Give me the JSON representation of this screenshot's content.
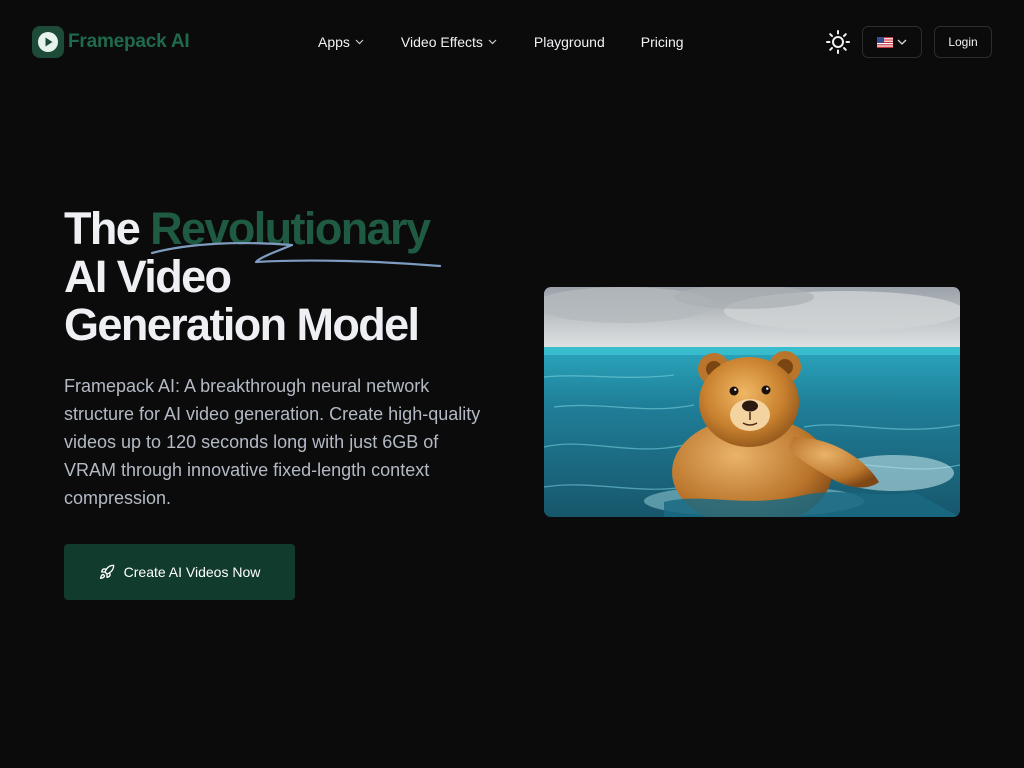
{
  "brand": {
    "name": "Framepack AI",
    "accent_color": "#1f6a4c"
  },
  "nav": {
    "items": [
      {
        "label": "Apps",
        "has_dropdown": true
      },
      {
        "label": "Video Effects",
        "has_dropdown": true
      },
      {
        "label": "Playground",
        "has_dropdown": false
      },
      {
        "label": "Pricing",
        "has_dropdown": false
      }
    ]
  },
  "header": {
    "theme_toggle_icon": "sun-icon",
    "language": {
      "icon": "us-flag-icon"
    },
    "login_label": "Login"
  },
  "hero": {
    "title_prefix": "The ",
    "title_accent": "Revolutionary",
    "title_line2": "AI Video",
    "title_line3": "Generation Model",
    "description": "Framepack AI: A breakthrough neural network structure for AI video generation. Create high-quality videos up to 120 seconds long with just 6GB of VRAM through innovative fixed-length context compression.",
    "cta_label": "Create AI Videos Now",
    "cta_icon": "rocket-icon",
    "media": {
      "subject": "teddy-bear-swimming-in-ocean"
    }
  },
  "colors": {
    "background": "#0b0b0c",
    "cta_background": "#113b2c",
    "title_accent": "#1f5a42",
    "squiggle": "#7e9cc0"
  }
}
